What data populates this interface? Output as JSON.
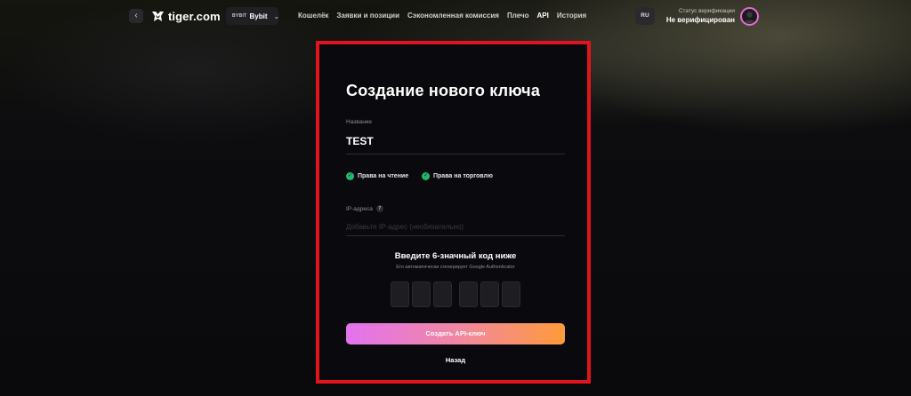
{
  "header": {
    "back_icon": "chevron-left-icon",
    "logo_text": "tiger.com",
    "logo_separator": "×",
    "exchange": {
      "mark": "BYBIT",
      "name": "Bybit",
      "icon": "chevron-down-icon"
    },
    "nav": [
      {
        "label": "Кошелёк",
        "active": false
      },
      {
        "label": "Заявки и позиции",
        "active": false
      },
      {
        "label": "Сэкономленная комиссия",
        "active": false
      },
      {
        "label": "Плечо",
        "active": false
      },
      {
        "label": "API",
        "active": true
      },
      {
        "label": "История",
        "active": false
      }
    ],
    "language": "RU",
    "verification": {
      "label": "Статус верификации",
      "status": "Не верифицирован"
    }
  },
  "form": {
    "title": "Создание нового ключа",
    "name_label": "Название",
    "name_value": "TEST",
    "permissions": [
      {
        "label": "Права на чтение",
        "checked": true
      },
      {
        "label": "Права на торговлю",
        "checked": true
      }
    ],
    "ip_label": "IP-адреса",
    "ip_info": "?",
    "ip_placeholder": "Добавьте IP-адрес (необязательно)",
    "ip_value": "",
    "code_title": "Введите 6-значный код ниже",
    "code_subtitle": "Его автоматически сгенерирует Google Authenticator",
    "code_digits": [
      "",
      "",
      "",
      "",
      "",
      ""
    ],
    "submit_label": "Создать API-ключ",
    "back_label": "Назад"
  },
  "colors": {
    "highlight_frame": "#e0141c",
    "check": "#20b86a",
    "button_gradient_start": "#e273f0",
    "button_gradient_end": "#ff9a3a",
    "avatar_ring": "#e86ad9"
  }
}
